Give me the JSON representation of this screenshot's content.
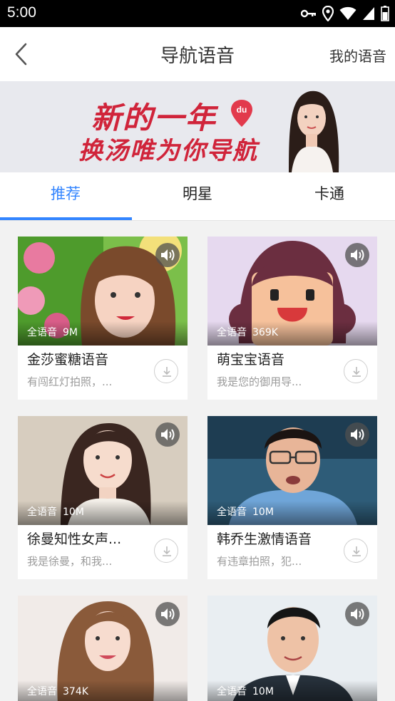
{
  "status_bar": {
    "time": "5:00",
    "icons": [
      "key-icon",
      "location-icon",
      "wifi-icon",
      "signal-icon",
      "battery-icon"
    ]
  },
  "header": {
    "title": "导航语音",
    "back_icon": "chevron-left-icon",
    "right_link": "我的语音"
  },
  "banner": {
    "line1": "新的一年",
    "line2": "换汤唯为你导航",
    "badge": "du",
    "colors": {
      "text": "#d0243a",
      "background": "#e8e9ee"
    }
  },
  "tabs": [
    {
      "label": "推荐",
      "active": true
    },
    {
      "label": "明星",
      "active": false
    },
    {
      "label": "卡通",
      "active": false
    }
  ],
  "accent_color": "#3385ff",
  "voices": [
    {
      "name": "金莎蜜糖语音",
      "desc": "有闯红灯拍照，...",
      "type": "全语音",
      "size": "9M",
      "image": "woman-with-flowers-photo"
    },
    {
      "name": "萌宝宝语音",
      "desc": "我是您的御用导...",
      "type": "全语音",
      "size": "369K",
      "image": "cartoon-girl-illustration"
    },
    {
      "name": "徐曼知性女声...",
      "desc": "我是徐曼，和我...",
      "type": "全语音",
      "size": "10M",
      "image": "woman-portrait-photo"
    },
    {
      "name": "韩乔生激情语音",
      "desc": "有违章拍照，犯...",
      "type": "全语音",
      "size": "10M",
      "image": "man-with-glasses-photo"
    },
    {
      "name": "",
      "desc": "",
      "type": "全语音",
      "size": "374K",
      "image": "woman-smiling-photo"
    },
    {
      "name": "",
      "desc": "",
      "type": "全语音",
      "size": "10M",
      "image": "man-in-suit-photo"
    }
  ]
}
